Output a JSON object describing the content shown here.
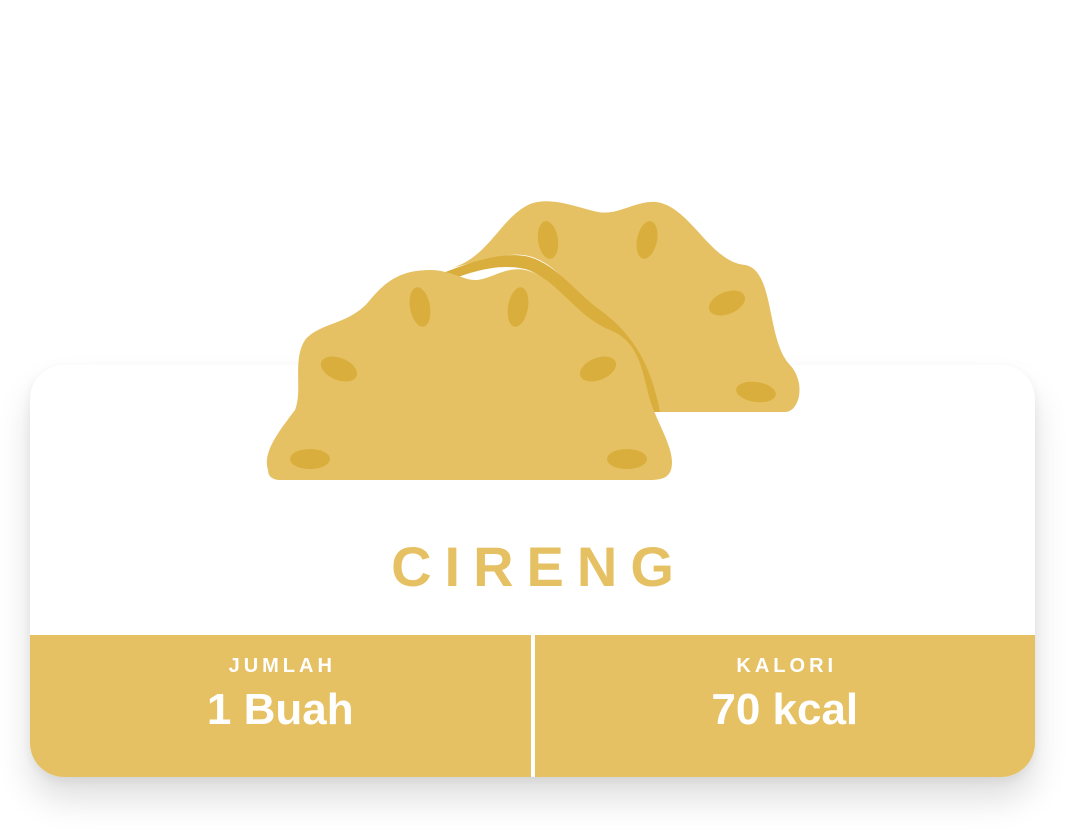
{
  "colors": {
    "accent": "#E6C163",
    "accent_dark": "#D9AE3C",
    "text_on_accent": "#FFFFFF",
    "card_background": "#FFFFFF"
  },
  "icon": "cireng-food-icon",
  "food": {
    "name": "CIRENG"
  },
  "info": {
    "quantity": {
      "label": "JUMLAH",
      "value": "1 Buah"
    },
    "calories": {
      "label": "KALORI",
      "value": "70 kcal"
    }
  }
}
